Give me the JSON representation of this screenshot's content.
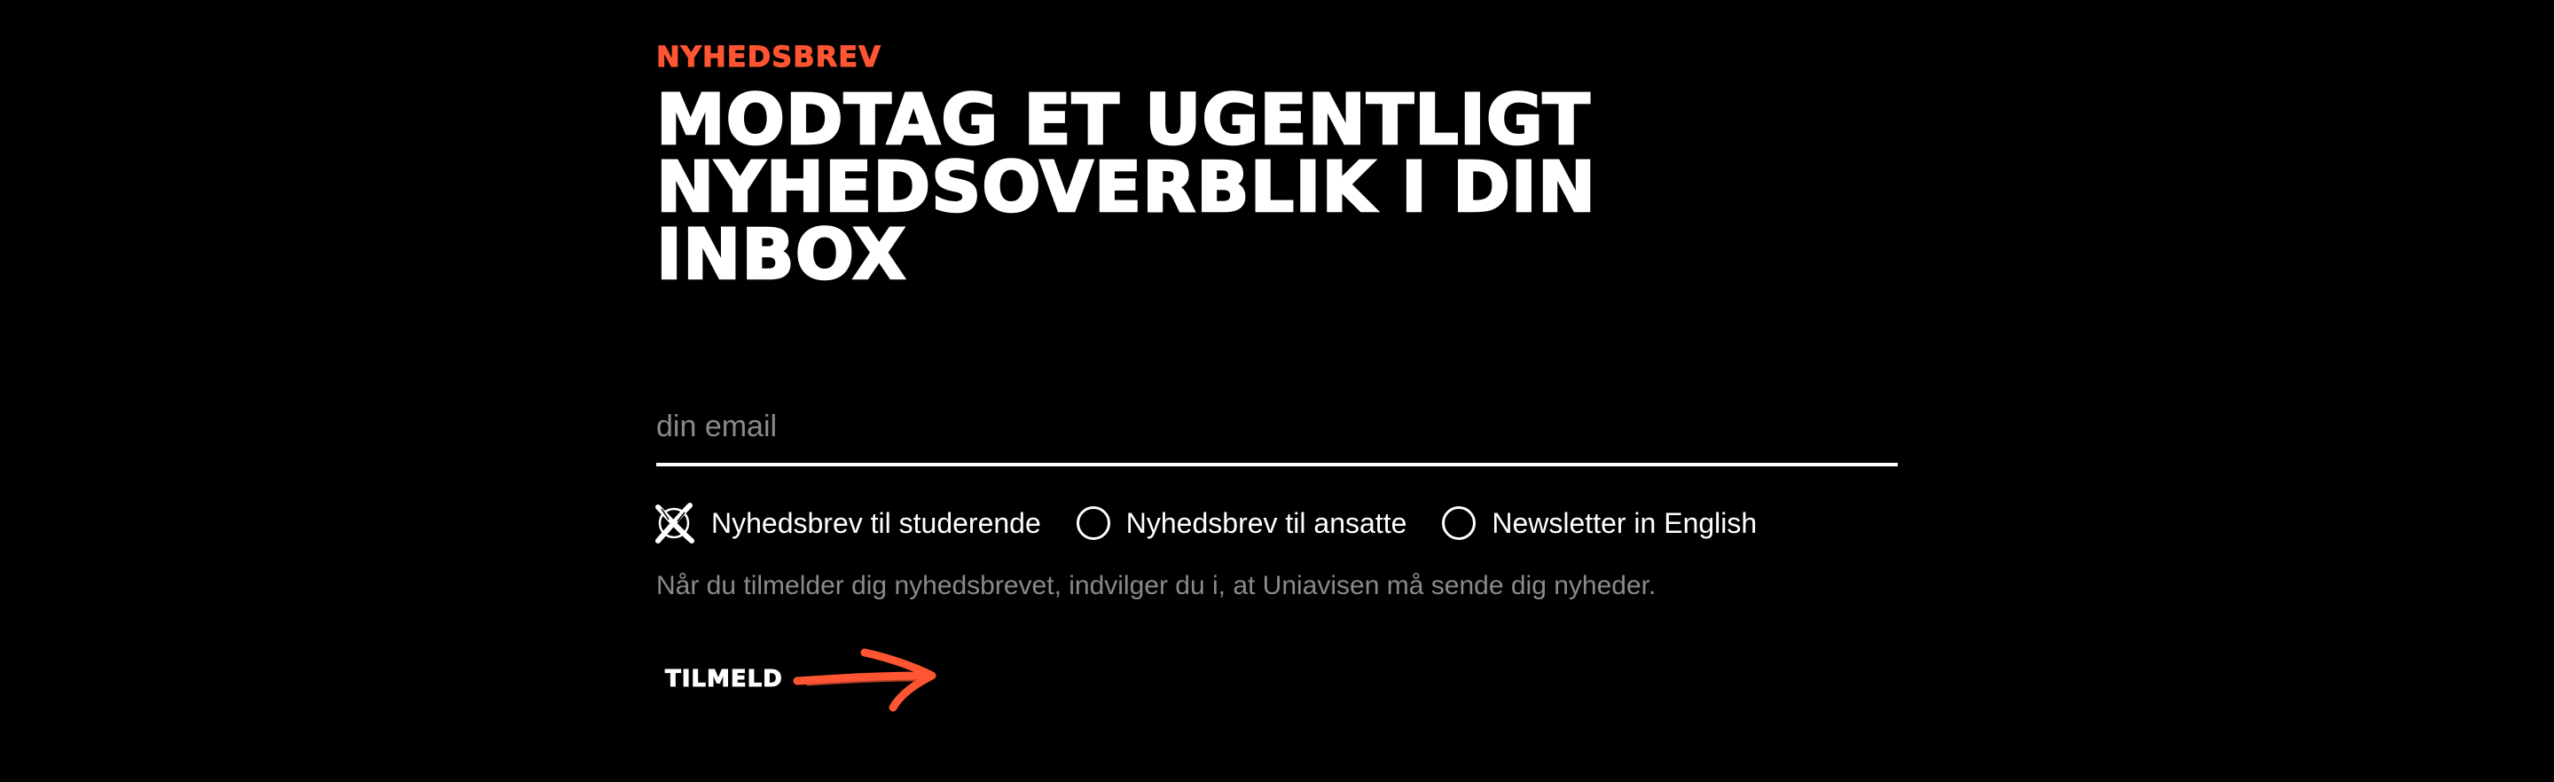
{
  "newsletter": {
    "eyebrow": "NYHEDSBREV",
    "headline_lines": [
      "MODTAG ET UGENTLIGT",
      "NYHEDSOVERBLIK I DIN",
      "INBOX"
    ],
    "email_placeholder": "din email",
    "options": [
      {
        "label": "Nyhedsbrev til studerende",
        "selected": true
      },
      {
        "label": "Nyhedsbrev til ansatte",
        "selected": false
      },
      {
        "label": "Newsletter in English",
        "selected": false
      }
    ],
    "consent": "Når du tilmelder dig nyhedsbrevet, indvilger du i, at Uniavisen må sende dig nyheder.",
    "submit_label": "TILMELD",
    "submit_icon": "arrow-right-icon",
    "selected_icon": "x-mark-icon"
  },
  "colors": {
    "background": "#000000",
    "accent": "#ff5533",
    "text": "#ffffff",
    "muted": "#8a8a8a"
  }
}
